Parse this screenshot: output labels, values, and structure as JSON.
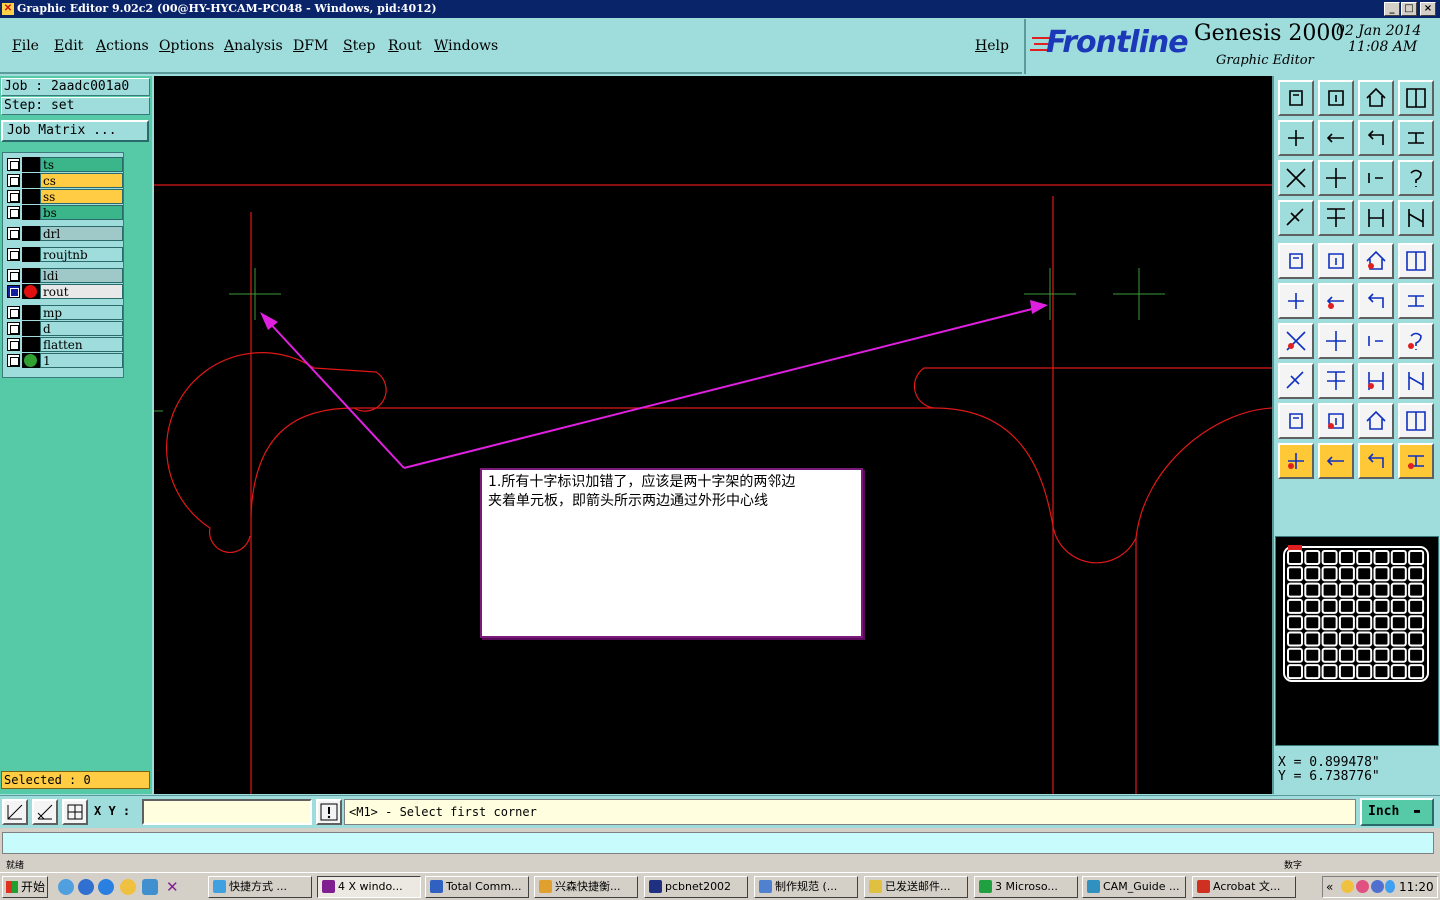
{
  "window": {
    "title": "Graphic Editor 9.02c2 (00@HY-HYCAM-PC048 - Windows, pid:4012)",
    "controls": {
      "minimize": "_",
      "maximize": "□",
      "close": "×"
    }
  },
  "menu": {
    "items": [
      "File",
      "Edit",
      "Actions",
      "Options",
      "Analysis",
      "DFM",
      "Step",
      "Rout",
      "Windows"
    ],
    "help": "Help"
  },
  "brand": {
    "logo": "Frontline",
    "product": "Genesis 2000",
    "subtitle": "Graphic Editor",
    "date": "02 Jan 2014",
    "time": "11:08 AM"
  },
  "left_panel": {
    "job_label": "Job : 2aadc001a0",
    "step_label": "Step: set",
    "job_matrix_button": "Job Matrix ...",
    "selected_label": "Selected : 0",
    "layers": [
      {
        "name": "ts",
        "color": "#3bb58a",
        "active": false,
        "dot": ""
      },
      {
        "name": "cs",
        "color": "#ffcc44",
        "active": false,
        "dot": ""
      },
      {
        "name": "ss",
        "color": "#ffcc44",
        "active": false,
        "dot": ""
      },
      {
        "name": "bs",
        "color": "#3bb58a",
        "active": false,
        "dot": ""
      },
      {
        "name": "drl",
        "color": "#9fc8c8",
        "active": false,
        "dot": ""
      },
      {
        "name": "roujtnb",
        "color": "#9fdcdc",
        "active": false,
        "dot": ""
      },
      {
        "name": "ldi",
        "color": "#9fc8c8",
        "active": false,
        "dot": ""
      },
      {
        "name": "rout",
        "color": "#e8e8e8",
        "active": true,
        "dot": "#e01010"
      },
      {
        "name": "mp",
        "color": "#9fdcdc",
        "active": false,
        "dot": ""
      },
      {
        "name": "d",
        "color": "#9fdcdc",
        "active": false,
        "dot": ""
      },
      {
        "name": "flatten",
        "color": "#9fdcdc",
        "active": false,
        "dot": ""
      },
      {
        "name": "1",
        "color": "#9fdcdc",
        "active": false,
        "dot": "#30a030"
      }
    ]
  },
  "canvas": {
    "annotation_line1": "1.所有十字标识加错了，应该是两十字架的两邻边",
    "annotation_line2": "夹着单元板，即箭头所示两边通过外形中心线",
    "profile_color": "#e01818",
    "cross_color": "#3a9a3a",
    "arrow_color": "#e020e0"
  },
  "coords": {
    "x_label": "X = 0.899478\"",
    "y_label": "Y = 6.738776\""
  },
  "command_bar": {
    "xy_label": "X Y :",
    "xy_value": "",
    "message": "<M1> - Select first corner",
    "units": "Inch"
  },
  "statusbar": {
    "left_text": "就绪",
    "right_text": "数字"
  },
  "taskbar": {
    "start": "开始",
    "tasks": [
      {
        "label": "快捷方式 ...",
        "active": false
      },
      {
        "label": "4 X windo...",
        "active": true
      },
      {
        "label": "Total Comm...",
        "active": false
      },
      {
        "label": "兴森快捷衡...",
        "active": false
      },
      {
        "label": "pcbnet2002",
        "active": false
      },
      {
        "label": "制作规范 (...",
        "active": false
      },
      {
        "label": "已发送邮件...",
        "active": false
      },
      {
        "label": "3 Microso...",
        "active": false
      },
      {
        "label": "CAM_Guide ...",
        "active": false
      },
      {
        "label": "Acrobat 文...",
        "active": false
      }
    ],
    "tray_chevron": "«",
    "clock": "11:20"
  }
}
